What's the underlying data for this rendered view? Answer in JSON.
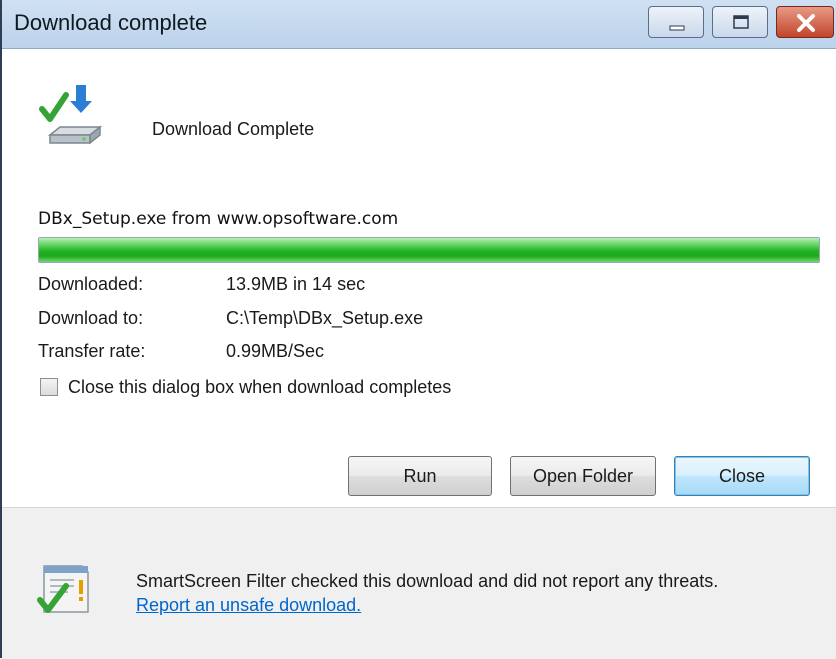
{
  "window": {
    "title": "Download complete"
  },
  "titlebar_controls": {
    "minimize": "minimize-icon",
    "maximize": "maximize-icon",
    "close": "close-icon"
  },
  "main": {
    "heading": "Download Complete",
    "source": "DBx_Setup.exe from www.opsoftware.com",
    "progress_percent": 100,
    "details": [
      {
        "label": "Downloaded:",
        "value": "13.9MB in 14 sec"
      },
      {
        "label": "Download to:",
        "value": "C:\\Temp\\DBx_Setup.exe"
      },
      {
        "label": "Transfer rate:",
        "value": "0.99MB/Sec"
      }
    ],
    "checkbox": {
      "label": "Close this dialog box when download completes",
      "checked": false
    }
  },
  "buttons": {
    "run": "Run",
    "open_folder": "Open Folder",
    "close": "Close"
  },
  "footer": {
    "text_before_link": "SmartScreen Filter checked this download and did not report any threats. ",
    "link": "Report an unsafe download."
  },
  "colors": {
    "progress": "#1fb21f",
    "link": "#0066cc",
    "title_bar": "#c4d9ef",
    "close_button": "#c2442b"
  },
  "icons": {
    "download": "download-complete-icon",
    "smartscreen": "smartscreen-shield-icon"
  }
}
